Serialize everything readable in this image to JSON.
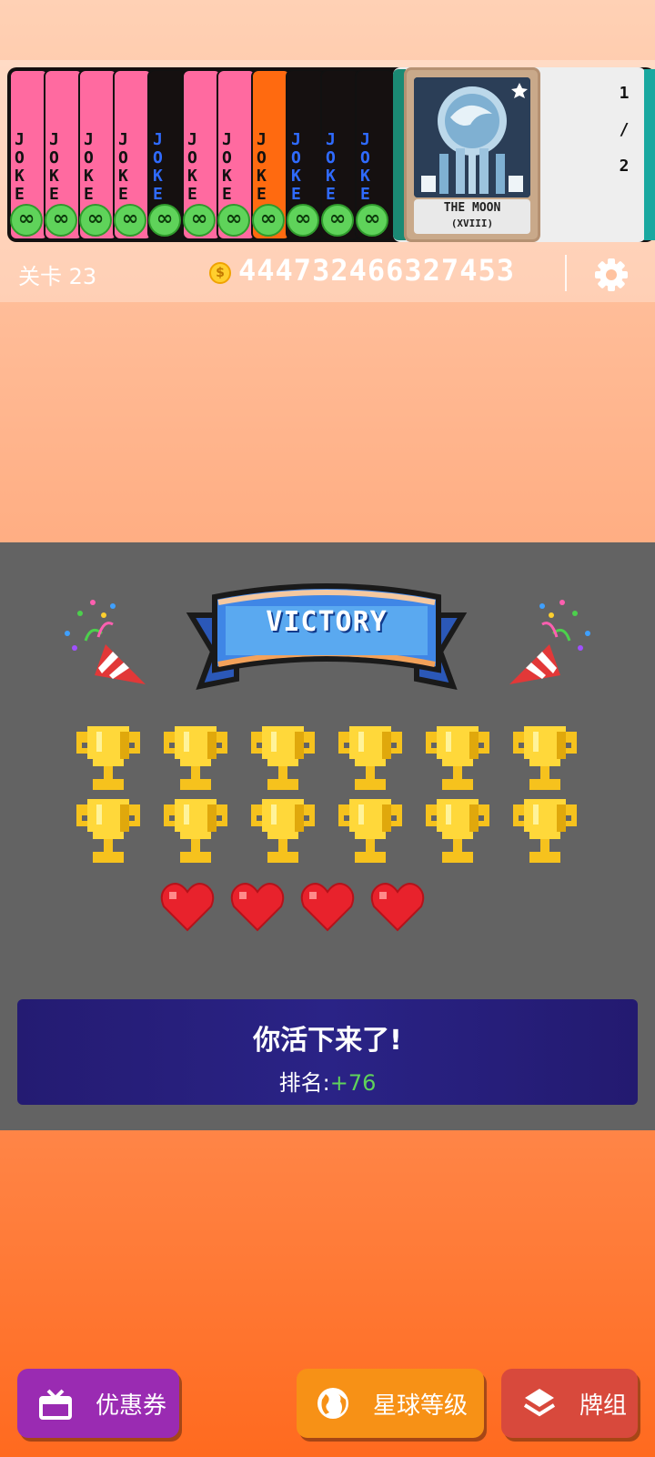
{
  "deck_strip": {
    "jokers": [
      {
        "color": "#ff6aa0",
        "text_color": "#111111",
        "label": "JOKE",
        "badge": "∞"
      },
      {
        "color": "#ff6aa0",
        "text_color": "#111111",
        "label": "JOKE",
        "badge": "∞"
      },
      {
        "color": "#ff6aa0",
        "text_color": "#111111",
        "label": "JOKE",
        "badge": "∞"
      },
      {
        "color": "#ff6aa0",
        "text_color": "#111111",
        "label": "JOKE",
        "badge": "∞"
      },
      {
        "color": "#151010",
        "text_color": "#2f6bff",
        "label": "JOKE",
        "badge": "∞"
      },
      {
        "color": "#ff6aa0",
        "text_color": "#111111",
        "label": "JOKE",
        "badge": "∞"
      },
      {
        "color": "#ff6aa0",
        "text_color": "#111111",
        "label": "JOKE",
        "badge": "∞"
      },
      {
        "color": "#ff6a10",
        "text_color": "#111111",
        "label": "JOKE",
        "badge": "∞"
      },
      {
        "color": "#151010",
        "text_color": "#2f6bff",
        "label": "JOKE",
        "badge": "∞"
      },
      {
        "color": "#151010",
        "text_color": "#2f6bff",
        "label": "JOKE",
        "badge": "∞"
      },
      {
        "color": "#151010",
        "text_color": "#2f6bff",
        "label": "JOKE",
        "badge": "∞"
      }
    ],
    "featured_card": {
      "title": "THE MOON",
      "numeral": "(XVIII)"
    },
    "page_indicator": {
      "current": "1",
      "separator": "/",
      "total": "2"
    }
  },
  "status_bar": {
    "level_label": "关卡 23",
    "coin_symbol": "$",
    "coins": "44473246632745З"
  },
  "victory": {
    "banner_text": "VICTORY",
    "trophy_count": 12,
    "heart_count": 4,
    "result_title": "你活下来了!",
    "rank_label": "排名:",
    "rank_value": "+76"
  },
  "buttons": {
    "coupon": "优惠券",
    "planet_level": "星球等级",
    "deck": "牌组"
  },
  "colors": {
    "panel_gray": "#636363",
    "result_bg": "#2a2386",
    "rank_green": "#5fd35a",
    "coupon_purple": "#9a2bb2",
    "planet_orange": "#f79116",
    "deck_red": "#d8493c"
  }
}
